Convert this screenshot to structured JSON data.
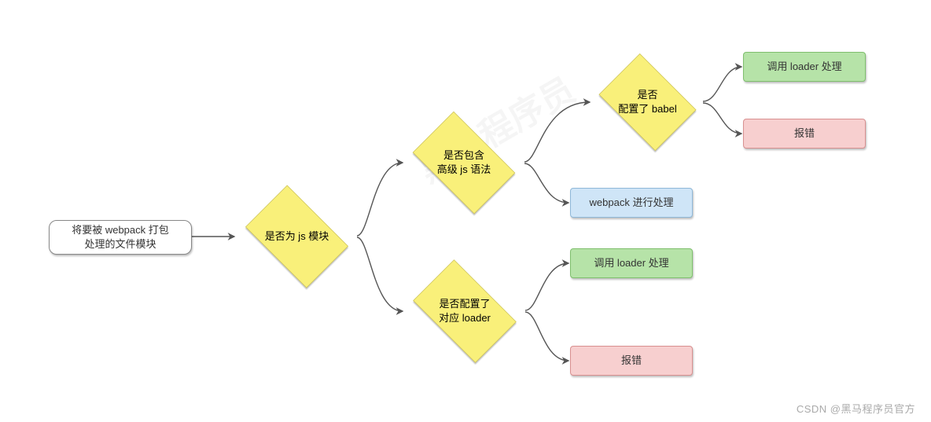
{
  "diagram": {
    "start": "将要被 webpack 打包\n处理的文件模块",
    "decision_js_module": "是否为 js 模块",
    "decision_advanced_js": "是否包含\n高级 js 语法",
    "decision_babel": "是否\n配置了 babel",
    "decision_loader": "是否配置了\n对应 loader",
    "result_loader_top": "调用 loader 处理",
    "result_error_top": "报错",
    "result_webpack": "webpack 进行处理",
    "result_loader_bottom": "调用 loader 处理",
    "result_error_bottom": "报错"
  },
  "watermark_footer": "CSDN @黑马程序员官方",
  "watermark_bg": "黑马程序员"
}
